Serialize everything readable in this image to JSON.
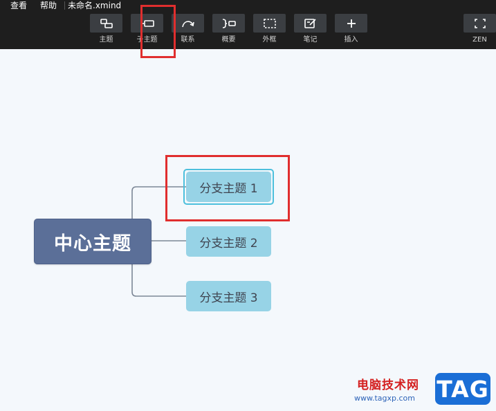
{
  "menubar": {
    "view": "查看",
    "help": "帮助",
    "filename": "未命名.xmind"
  },
  "toolbar": {
    "tools": [
      {
        "label": "主题",
        "icon": "topic-icon"
      },
      {
        "label": "子主题",
        "icon": "subtopic-icon"
      },
      {
        "label": "联系",
        "icon": "relationship-icon"
      },
      {
        "label": "概要",
        "icon": "summary-icon"
      },
      {
        "label": "外框",
        "icon": "boundary-icon"
      },
      {
        "label": "笔记",
        "icon": "note-icon"
      },
      {
        "label": "插入",
        "icon": "insert-icon"
      },
      {
        "label": "ZEN",
        "icon": "zen-fullscreen-icon"
      }
    ]
  },
  "mindmap": {
    "central": "中心主题",
    "branches": [
      "分支主题 1",
      "分支主题 2",
      "分支主题 3"
    ],
    "selected_branch": 1
  },
  "watermark": {
    "site_cn": "电脑技术网",
    "url": "www.tagxp.com",
    "tag": "TAG"
  },
  "colors": {
    "toolbar_bg": "#1e1e1e",
    "canvas_bg": "#f4f8fc",
    "central_fill": "#5b6f98",
    "branch_fill": "#97d3e6",
    "selection_ring": "#4cbfdc",
    "highlight": "#e02e2e",
    "connector": "#7c8796"
  }
}
